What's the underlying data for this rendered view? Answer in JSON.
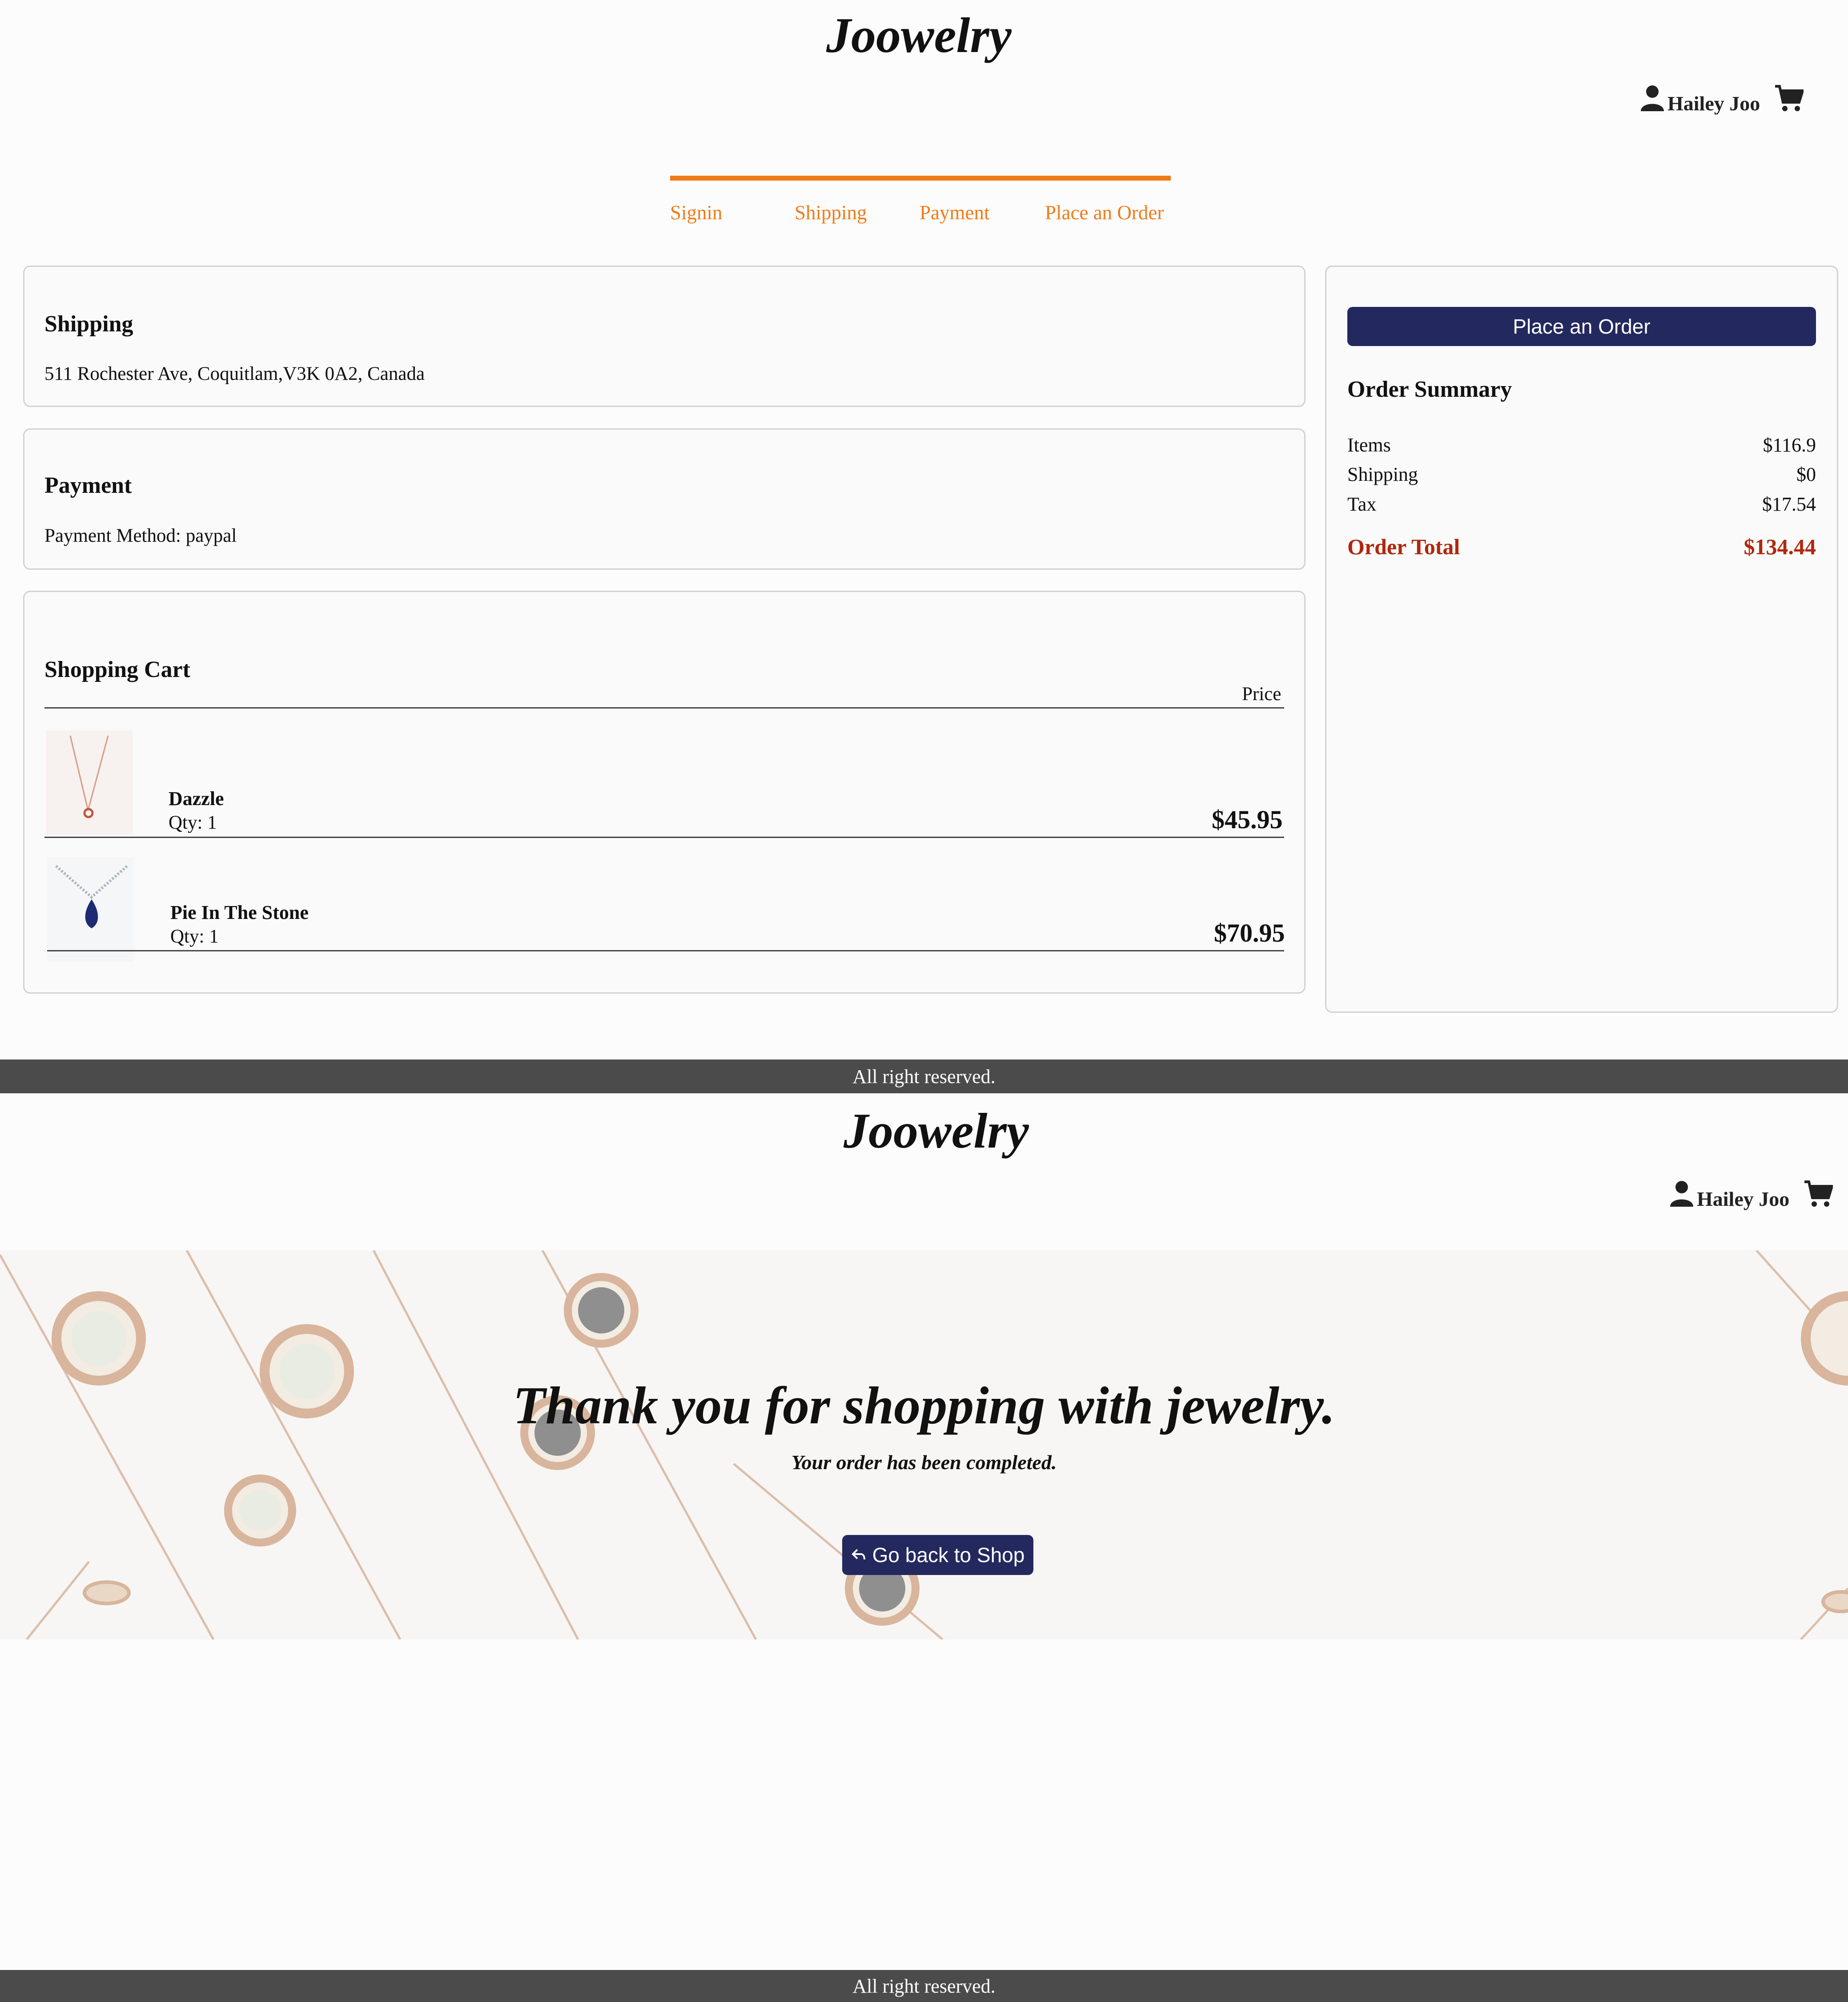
{
  "checkout": {
    "brand": "Joowelry",
    "user_name": "Hailey Joo",
    "steps": [
      "Signin",
      "Shipping",
      "Payment",
      "Place an Order"
    ],
    "shipping": {
      "title": "Shipping",
      "address": "511 Rochester Ave, Coquitlam,V3K 0A2, Canada"
    },
    "payment": {
      "title": "Payment",
      "method": "Payment Method: paypal"
    },
    "cart": {
      "title": "Shopping Cart",
      "price_header": "Price",
      "items": [
        {
          "name": "Dazzle",
          "qty": "Qty: 1",
          "price": "$45.95"
        },
        {
          "name": "Pie In The Stone",
          "qty": "Qty: 1",
          "price": "$70.95"
        }
      ]
    },
    "summary": {
      "button": "Place an Order",
      "title": "Order Summary",
      "items_label": "Items",
      "items_value": "$116.9",
      "shipping_label": "Shipping",
      "shipping_value": "$0",
      "tax_label": "Tax",
      "tax_value": "$17.54",
      "total_label": "Order Total",
      "total_value": "$134.44"
    },
    "footer": "All right reserved."
  },
  "confirmation": {
    "brand": "Joowelry",
    "user_name": "Hailey Joo",
    "title": "Thank you for shopping with jewelry.",
    "subtitle": "Your order has been completed.",
    "back_button": "Go back to Shop",
    "footer": "All right reserved."
  },
  "colors": {
    "accent_orange": "#ef7c1a",
    "primary_navy": "#23295e",
    "total_red": "#b0270d",
    "footer_gray": "#4b4b4b"
  },
  "icons": [
    "user-icon",
    "cart-icon",
    "back-arrow-icon"
  ]
}
